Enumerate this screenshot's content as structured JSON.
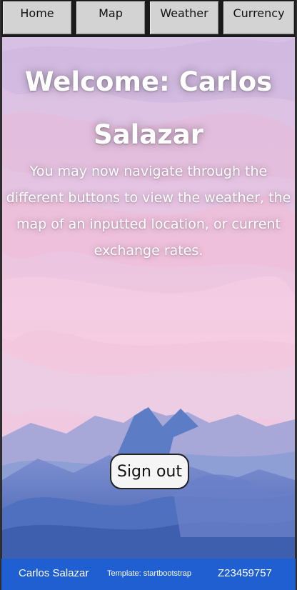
{
  "nav": {
    "items": [
      {
        "label": "Home"
      },
      {
        "label": "Map"
      },
      {
        "label": "Weather"
      },
      {
        "label": "Currency"
      }
    ]
  },
  "hero": {
    "welcome": "Welcome: Carlos Salazar",
    "intro": "You may now navigate through the different buttons to view the weather, the map of an inputted location, or current exchange rates.",
    "signout_label": "Sign out"
  },
  "footer": {
    "name": "Carlos Salazar",
    "template": "Template: startbootstrap",
    "id": "Z23459757"
  },
  "colors": {
    "footer_bg": "#1f5fd1",
    "sky_top": "#d9c3e6",
    "sky_pink": "#f2c6de",
    "mountain_blue": "#5a77c4"
  }
}
